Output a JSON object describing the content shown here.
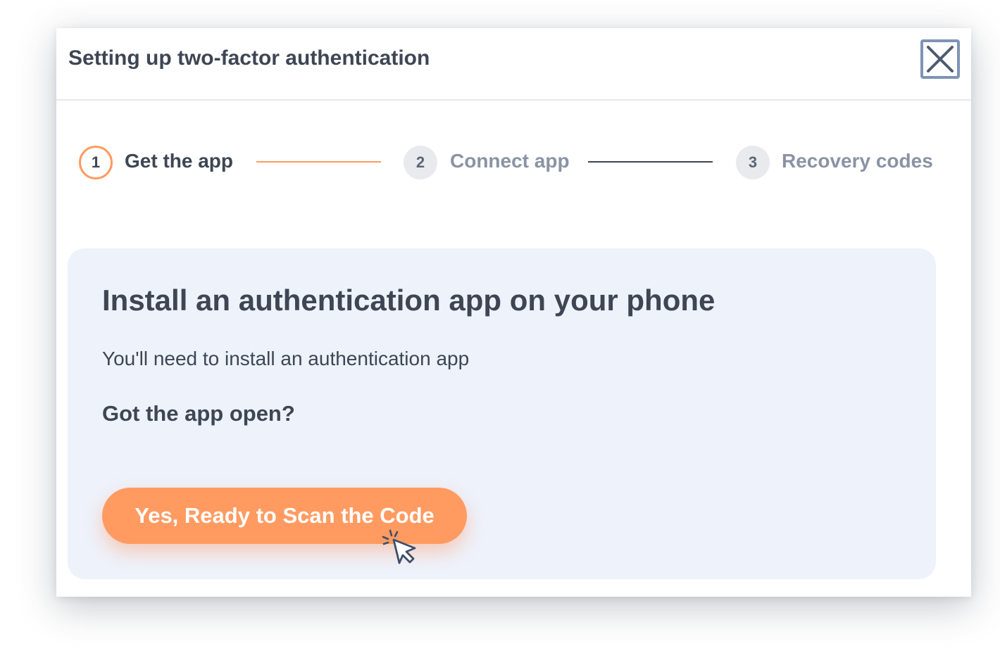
{
  "modal": {
    "title": "Setting up two-factor authentication",
    "close_icon": "close-icon"
  },
  "stepper": {
    "steps": [
      {
        "number": "1",
        "label": "Get the app",
        "state": "active"
      },
      {
        "number": "2",
        "label": "Connect app",
        "state": "inactive"
      },
      {
        "number": "3",
        "label": "Recovery codes",
        "state": "inactive"
      }
    ],
    "connector_colors": [
      "#ff9b61",
      "#3e4654"
    ]
  },
  "panel": {
    "heading": "Install an authentication app on your phone",
    "description": "You'll need to install an authentication app",
    "question": "Got the app open?",
    "primary_button_label": "Yes, Ready to Scan the Code",
    "pointer_icon": "click-cursor-icon"
  },
  "colors": {
    "accent": "#ff9b61",
    "text": "#3e4654",
    "muted_text": "#8a93a4",
    "panel_background": "#eef2fb",
    "close_border": "#7e93b6"
  }
}
